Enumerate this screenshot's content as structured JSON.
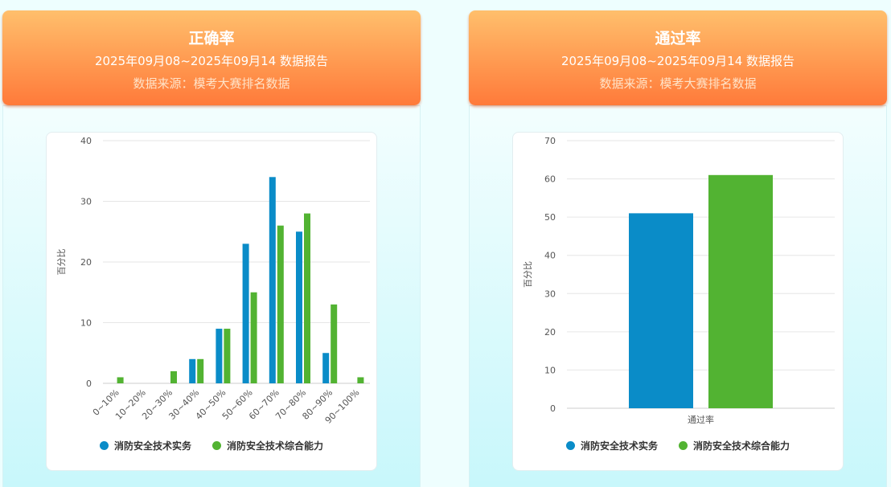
{
  "colors": {
    "series1": "#0a8cc8",
    "series2": "#52b332",
    "grid": "#e6e6e6",
    "tick": "#555555"
  },
  "panels": [
    {
      "title": "正确率",
      "subtitle": "2025年09月08~2025年09月14 数据报告",
      "source": "数据来源：模考大赛排名数据",
      "legend": [
        "消防安全技术实务",
        "消防安全技术综合能力"
      ]
    },
    {
      "title": "通过率",
      "subtitle": "2025年09月08~2025年09月14 数据报告",
      "source": "数据来源：模考大赛排名数据",
      "legend": [
        "消防安全技术实务",
        "消防安全技术综合能力"
      ]
    }
  ],
  "chart_data": [
    {
      "type": "bar",
      "title": "",
      "xlabel": "",
      "ylabel": "百分比",
      "categories": [
        "0~10%",
        "10~20%",
        "20~30%",
        "30~40%",
        "40~50%",
        "50~60%",
        "60~70%",
        "70~80%",
        "80~90%",
        "90~100%"
      ],
      "series": [
        {
          "name": "消防安全技术实务",
          "values": [
            0,
            0,
            0,
            4,
            9,
            23,
            34,
            25,
            5,
            0
          ]
        },
        {
          "name": "消防安全技术综合能力",
          "values": [
            1,
            0,
            2,
            4,
            9,
            15,
            26,
            28,
            13,
            1
          ]
        }
      ],
      "ylim": [
        0,
        40
      ],
      "yticks": [
        0,
        10,
        20,
        30,
        40
      ],
      "grid": true,
      "legend": "bottom"
    },
    {
      "type": "bar",
      "title": "",
      "xlabel": "",
      "ylabel": "百分比",
      "categories": [
        "通过率"
      ],
      "series": [
        {
          "name": "消防安全技术实务",
          "values": [
            51
          ]
        },
        {
          "name": "消防安全技术综合能力",
          "values": [
            61
          ]
        }
      ],
      "ylim": [
        0,
        70
      ],
      "yticks": [
        0,
        10,
        20,
        30,
        40,
        50,
        60,
        70
      ],
      "grid": true,
      "legend": "bottom"
    }
  ]
}
